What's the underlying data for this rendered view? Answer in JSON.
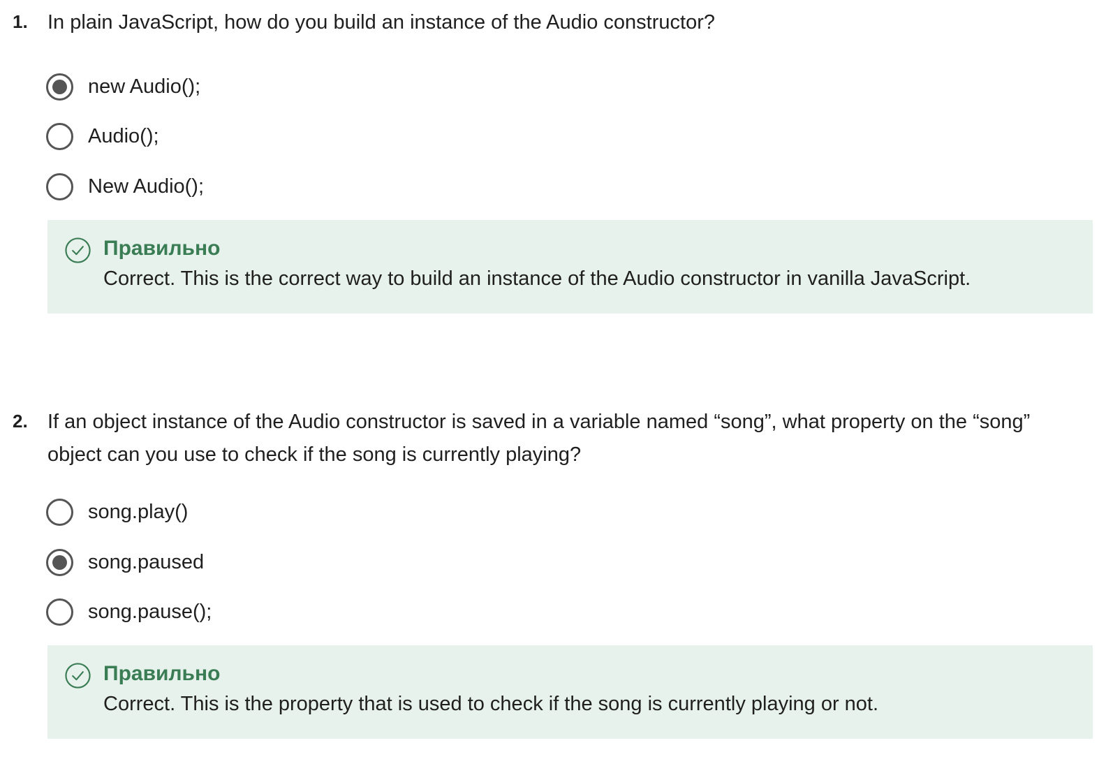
{
  "questions": [
    {
      "number": "1.",
      "text": "In plain JavaScript, how do you build an instance of the Audio constructor?",
      "options": [
        {
          "label": "new Audio();",
          "selected": true
        },
        {
          "label": "Audio();",
          "selected": false
        },
        {
          "label": "New Audio();",
          "selected": false
        }
      ],
      "feedback": {
        "status": "Правильно",
        "message": "Correct. This is the correct way to build an instance of the Audio constructor in vanilla JavaScript.",
        "icon": "check-circle-icon",
        "color": "#3a7d55"
      }
    },
    {
      "number": "2.",
      "text": "If an object instance of the Audio constructor is saved in a variable named “song”, what property on the “song” object can you use to check if the song is currently playing?",
      "options": [
        {
          "label": "song.play()",
          "selected": false
        },
        {
          "label": "song.paused",
          "selected": true
        },
        {
          "label": "song.pause();",
          "selected": false
        }
      ],
      "feedback": {
        "status": "Правильно",
        "message": "Correct. This is the property that is used to check if the song is currently playing or not.",
        "icon": "check-circle-icon",
        "color": "#3a7d55"
      }
    }
  ]
}
